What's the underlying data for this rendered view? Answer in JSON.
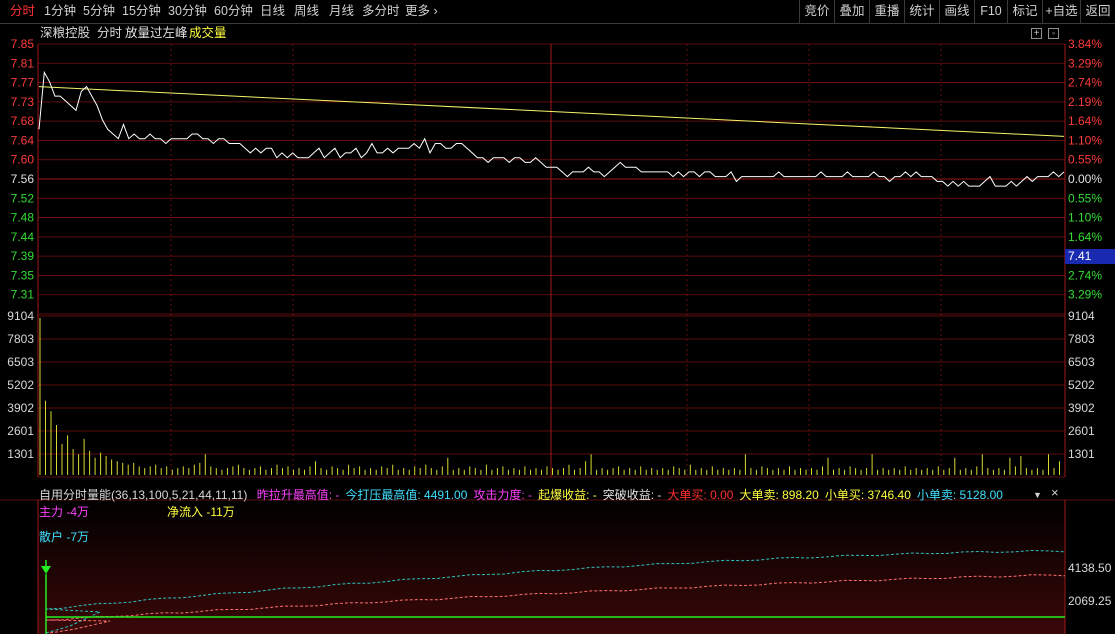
{
  "toolbar": {
    "periods": [
      "分时",
      "1分钟",
      "5分钟",
      "15分钟",
      "30分钟",
      "60分钟",
      "日线",
      "周线",
      "月线",
      "多分时",
      "更多"
    ],
    "more_arrow": "›",
    "right_items": [
      "竞价",
      "叠加",
      "重播",
      "统计",
      "画线",
      "F10",
      "标记",
      "+自选",
      "返回"
    ]
  },
  "header": {
    "stock_name": "深粮控股",
    "chart_mode": "分时",
    "signal": "放量过左峰",
    "volume_label": "成交量"
  },
  "price_axis": {
    "left_labels": [
      "7.85",
      "7.81",
      "7.77",
      "7.73",
      "7.68",
      "7.64",
      "7.60",
      "7.56",
      "7.52",
      "7.48",
      "7.44",
      "7.39",
      "7.35",
      "7.31"
    ],
    "right_labels": [
      "3.84%",
      "3.29%",
      "2.74%",
      "2.19%",
      "1.64%",
      "1.10%",
      "0.55%",
      "0.00%",
      "0.55%",
      "1.10%",
      "1.64%",
      "2.19%",
      "2.74%",
      "3.29%"
    ],
    "current_price_tag": "7.41",
    "colors": {
      "up": "#ff3b3b",
      "flat": "#e0e0e0",
      "down": "#33dd33"
    }
  },
  "volume_axis": {
    "labels": [
      "9104",
      "7803",
      "6503",
      "5202",
      "3902",
      "2601",
      "1301"
    ]
  },
  "indicator": {
    "title": "自用分时量能(36,13,100,5,21,44,11,11)",
    "fields": [
      {
        "label": "昨拉升最高值:",
        "value": "-",
        "color": "#ff40ff"
      },
      {
        "label": "今打压最高值:",
        "value": "4491.00",
        "color": "#40e0ff"
      },
      {
        "label": "攻击力度:",
        "value": "-",
        "color": "#ff40ff"
      },
      {
        "label": "起爆收益:",
        "value": "-",
        "color": "#ffff40"
      },
      {
        "label": "突破收益:",
        "value": "-",
        "color": "#e0e0e0"
      },
      {
        "label": "大单买:",
        "value": "0.00",
        "color": "#ff3030"
      },
      {
        "label": "大单卖:",
        "value": "898.20",
        "color": "#ffff40"
      },
      {
        "label": "小单买:",
        "value": "3746.40",
        "color": "#ffff40"
      },
      {
        "label": "小单卖:",
        "value": "5128.00",
        "color": "#40e0ff"
      }
    ],
    "main_force": "主力 -4万",
    "net_inflow": "净流入 -11万",
    "retail": "散户 -7万",
    "right_labels": [
      "4138.50",
      "2069.25"
    ],
    "dropdown_glyph": "▼",
    "close_glyph": "×"
  },
  "chart_data": {
    "type": "line",
    "series": [
      {
        "name": "",
        "role": "price",
        "color": "#ffffff",
        "values": [
          7.68,
          7.8,
          7.78,
          7.75,
          7.75,
          7.74,
          7.73,
          7.72,
          7.76,
          7.77,
          7.75,
          7.73,
          7.7,
          7.68,
          7.67,
          7.66,
          7.69,
          7.66,
          7.67,
          7.66,
          7.66,
          7.67,
          7.66,
          7.66,
          7.65,
          7.66,
          7.66,
          7.66,
          7.66,
          7.67,
          7.67,
          7.66,
          7.66,
          7.65,
          7.66,
          7.66,
          7.65,
          7.65,
          7.65,
          7.64,
          7.63,
          7.64,
          7.63,
          7.64,
          7.64,
          7.62,
          7.63,
          7.62,
          7.63,
          7.62,
          7.62,
          7.62,
          7.63,
          7.64,
          7.62,
          7.63,
          7.64,
          7.62,
          7.63,
          7.63,
          7.64,
          7.62,
          7.63,
          7.65,
          7.63,
          7.63,
          7.64,
          7.63,
          7.64,
          7.64,
          7.64,
          7.65,
          7.64,
          7.66,
          7.63,
          7.65,
          7.65,
          7.64,
          7.64,
          7.65,
          7.65,
          7.64,
          7.63,
          7.62,
          7.62,
          7.61,
          7.62,
          7.62,
          7.62,
          7.61,
          7.62,
          7.62,
          7.61,
          7.61,
          7.62,
          7.61,
          7.6,
          7.6,
          7.6,
          7.59,
          7.58,
          7.59,
          7.59,
          7.59,
          7.6,
          7.59,
          7.59,
          7.58,
          7.59,
          7.6,
          7.61,
          7.6,
          7.6,
          7.6,
          7.59,
          7.59,
          7.59,
          7.59,
          7.59,
          7.59,
          7.58,
          7.59,
          7.58,
          7.59,
          7.59,
          7.58,
          7.59,
          7.59,
          7.58,
          7.58,
          7.58,
          7.59,
          7.57,
          7.58,
          7.58,
          7.58,
          7.58,
          7.58,
          7.58,
          7.58,
          7.59,
          7.58,
          7.58,
          7.58,
          7.58,
          7.58,
          7.58,
          7.58,
          7.59,
          7.58,
          7.58,
          7.58,
          7.58,
          7.59,
          7.58,
          7.58,
          7.58,
          7.58,
          7.59,
          7.58,
          7.58,
          7.57,
          7.58,
          7.58,
          7.59,
          7.58,
          7.59,
          7.58,
          7.58,
          7.58,
          7.57,
          7.57,
          7.56,
          7.57,
          7.56,
          7.57,
          7.56,
          7.56,
          7.56,
          7.57,
          7.58,
          7.56,
          7.56,
          7.56,
          7.57,
          7.56,
          7.57,
          7.58,
          7.57,
          7.58,
          7.58,
          7.58,
          7.59,
          7.58,
          7.59
        ]
      },
      {
        "name": "",
        "role": "average",
        "color": "#ffff66",
        "start": 7.77,
        "end": 7.665
      }
    ],
    "volume_bars": [
      9104,
      4300,
      3700,
      2900,
      1800,
      2300,
      1500,
      1200,
      2100,
      1400,
      1000,
      1300,
      1100,
      900,
      800,
      700,
      600,
      700,
      500,
      400,
      500,
      600,
      400,
      500,
      300,
      400,
      500,
      400,
      600,
      700,
      1200,
      500,
      400,
      300,
      400,
      500,
      600,
      400,
      300,
      400,
      500,
      300,
      400,
      600,
      400,
      500,
      300,
      400,
      300,
      500,
      800,
      400,
      300,
      500,
      400,
      300,
      600,
      400,
      500,
      300,
      400,
      300,
      500,
      400,
      600,
      300,
      400,
      300,
      500,
      400,
      600,
      400,
      300,
      500,
      1000,
      300,
      400,
      300,
      500,
      400,
      300,
      600,
      300,
      400,
      500,
      300,
      400,
      300,
      500,
      300,
      400,
      300,
      500,
      400,
      300,
      400,
      600,
      300,
      400,
      800,
      1200,
      300,
      400,
      300,
      400,
      500,
      300,
      400,
      300,
      500,
      300,
      400,
      300,
      400,
      300,
      500,
      400,
      300,
      600,
      300,
      400,
      300,
      500,
      300,
      400,
      300,
      400,
      300,
      1200,
      400,
      300,
      500,
      400,
      300,
      400,
      300,
      500,
      300,
      400,
      300,
      400,
      300,
      500,
      1000,
      300,
      400,
      300,
      500,
      400,
      300,
      400,
      1200,
      300,
      400,
      300,
      400,
      300,
      500,
      300,
      400,
      300,
      400,
      300,
      500,
      300,
      400,
      1000,
      300,
      400,
      300,
      500,
      1200,
      400,
      300,
      400,
      300,
      1000,
      500,
      1100,
      400,
      300,
      400,
      300,
      1200,
      400,
      800
    ],
    "ylim": [
      7.29,
      7.86
    ],
    "prev_close": 7.56,
    "grid": true
  }
}
